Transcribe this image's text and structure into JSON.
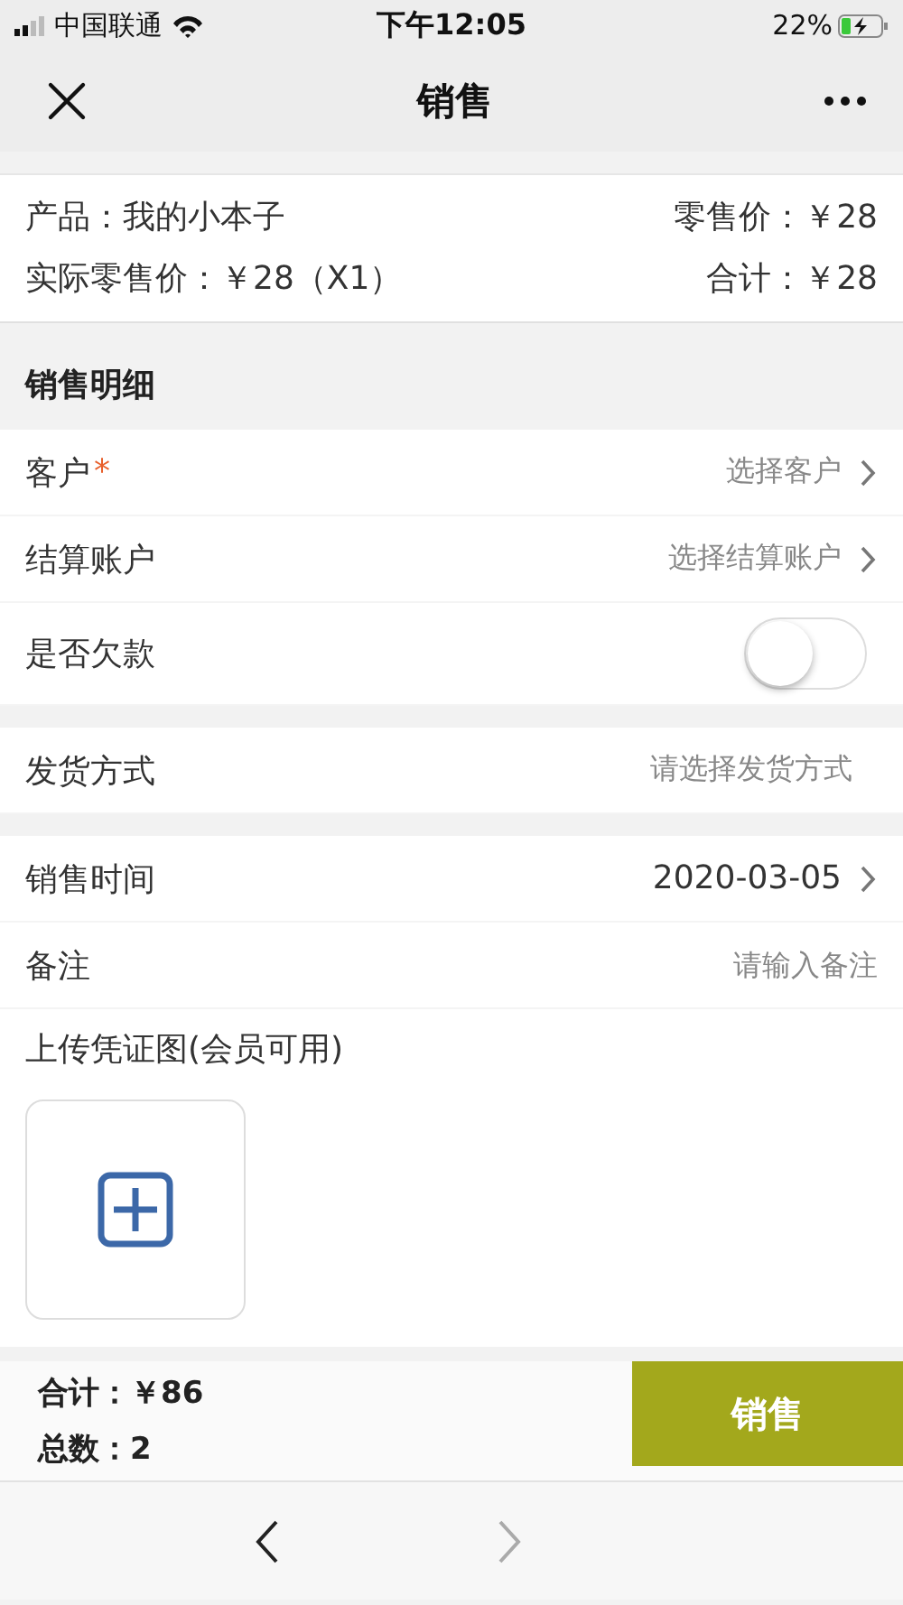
{
  "status_bar": {
    "carrier": "中国联通",
    "time": "下午12:05",
    "battery": "22%",
    "charging": true
  },
  "nav_bar": {
    "title": "销售"
  },
  "product": {
    "name": "产品：我的小本子",
    "retail_price": "零售价：￥28",
    "actual_price": "实际零售价：￥28（X1）",
    "subtotal": "合计：￥28"
  },
  "section_title": "销售明细",
  "groups": [
    {
      "rows": [
        {
          "kind": "picker",
          "label": "客户",
          "required_mark": "*",
          "placeholder": "选择客户",
          "chevron": true
        },
        {
          "kind": "picker",
          "label": "结算账户",
          "placeholder": "选择结算账户",
          "chevron": true
        },
        {
          "kind": "toggle",
          "label": "是否欠款",
          "on": false
        }
      ]
    },
    {
      "rows": [
        {
          "kind": "picker",
          "label": "发货方式",
          "placeholder": "请选择发货方式",
          "chevron": false
        }
      ]
    },
    {
      "rows": [
        {
          "kind": "picker",
          "label": "销售时间",
          "value": "2020-03-05",
          "chevron": true
        },
        {
          "kind": "input",
          "label": "备注",
          "placeholder": "请输入备注"
        }
      ]
    }
  ],
  "upload": {
    "label": "上传凭证图(会员可用)"
  },
  "summary": {
    "total": "合计：￥86",
    "count": "总数：2",
    "submit": "销售"
  },
  "browser_nav": {
    "back_disabled": false,
    "forward_disabled": true
  }
}
